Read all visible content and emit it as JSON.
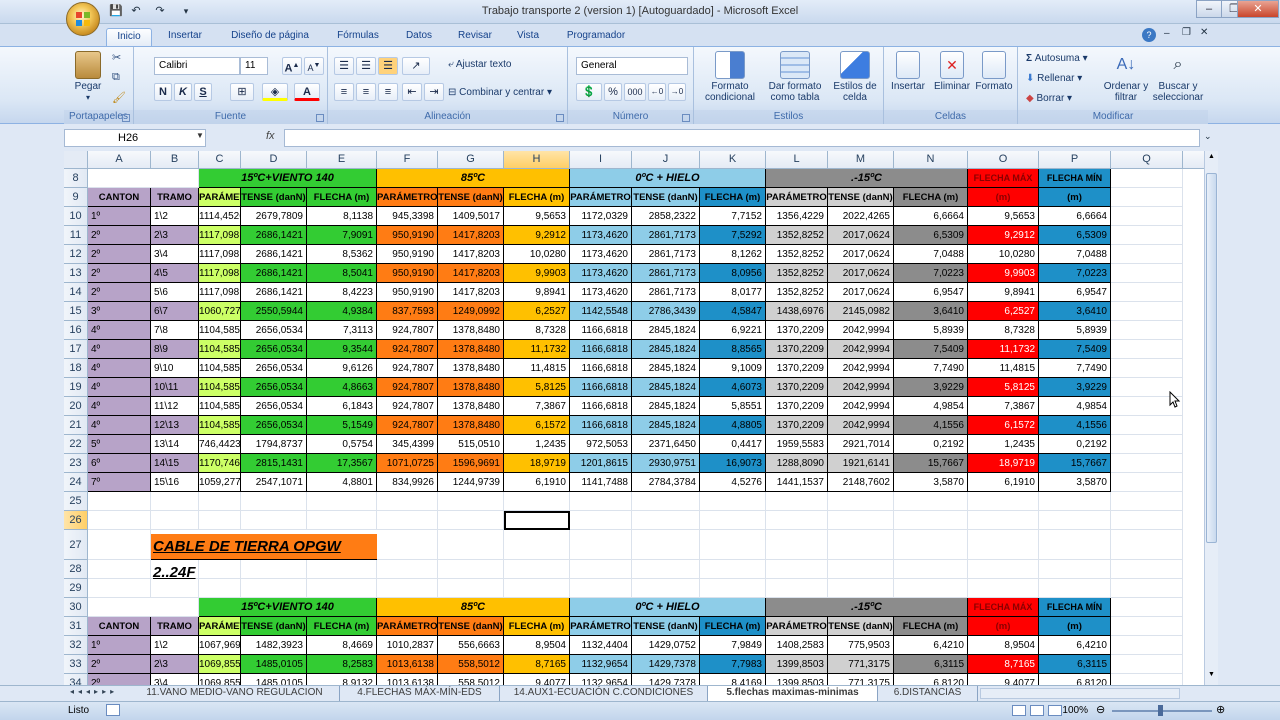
{
  "window": {
    "title": "Trabajo transporte 2 (version 1) [Autoguardado] - Microsoft Excel",
    "min": "–",
    "max": "❐",
    "close": "✕"
  },
  "qat": {
    "save": "💾",
    "undo": "↶",
    "redo": "↷"
  },
  "tabs": [
    "Inicio",
    "Insertar",
    "Diseño de página",
    "Fórmulas",
    "Datos",
    "Revisar",
    "Vista",
    "Programador"
  ],
  "ribbon": {
    "groups": {
      "clipboard": "Portapapeles",
      "font": "Fuente",
      "alignment": "Alineación",
      "number": "Número",
      "styles": "Estilos",
      "cells": "Celdas",
      "editing": "Modificar"
    },
    "paste": "Pegar",
    "font_name": "Calibri",
    "font_size": "11",
    "bold": "N",
    "italic": "K",
    "underline": "S",
    "wrap": "Ajustar texto",
    "merge": "Combinar y centrar",
    "number_format": "General",
    "cond_format": "Formato condicional",
    "table_format": "Dar formato como tabla",
    "cell_styles": "Estilos de celda",
    "insert": "Insertar",
    "delete": "Eliminar",
    "format": "Formato",
    "autosum": "Autosuma",
    "fill": "Rellenar",
    "clear": "Borrar",
    "sort": "Ordenar y filtrar",
    "find": "Buscar y seleccionar"
  },
  "formula_bar": {
    "name_box": "H26",
    "fx": "fx",
    "content": ""
  },
  "columns": [
    "A",
    "B",
    "C",
    "D",
    "E",
    "F",
    "G",
    "H",
    "I",
    "J",
    "K",
    "L",
    "M",
    "N",
    "O",
    "P",
    "Q"
  ],
  "table1": {
    "groups": [
      "15ºC+VIENTO 140",
      "85ºC",
      "0ºC + HIELO",
      ".-15ºC",
      "FLECHA MÁX",
      "FLECHA MÍN"
    ],
    "headers": [
      "CANTON",
      "TRAMO",
      "PARÁMETRO",
      "TENSE (danN)",
      "FLECHA (m)",
      "PARÁMETRO",
      "TENSE (danN)",
      "FLECHA (m)",
      "PARÁMETRO",
      "TENSE (danN)",
      "FLECHA (m)",
      "PARÁMETRO",
      "TENSE (danN)",
      "FLECHA (m)",
      "(m)",
      "(m)"
    ],
    "rows": [
      [
        "1º",
        "1\\2",
        "1114,4526",
        "2679,7809",
        "8,1138",
        "945,3398",
        "1409,5017",
        "9,5653",
        "1172,0329",
        "2858,2322",
        "7,7152",
        "1356,4229",
        "2022,4265",
        "6,6664",
        "9,5653",
        "6,6664"
      ],
      [
        "2º",
        "2\\3",
        "1117,0981",
        "2686,1421",
        "7,9091",
        "950,9190",
        "1417,8203",
        "9,2912",
        "1173,4620",
        "2861,7173",
        "7,5292",
        "1352,8252",
        "2017,0624",
        "6,5309",
        "9,2912",
        "6,5309"
      ],
      [
        "2º",
        "3\\4",
        "1117,0981",
        "2686,1421",
        "8,5362",
        "950,9190",
        "1417,8203",
        "10,0280",
        "1173,4620",
        "2861,7173",
        "8,1262",
        "1352,8252",
        "2017,0624",
        "7,0488",
        "10,0280",
        "7,0488"
      ],
      [
        "2º",
        "4\\5",
        "1117,0981",
        "2686,1421",
        "8,5041",
        "950,9190",
        "1417,8203",
        "9,9903",
        "1173,4620",
        "2861,7173",
        "8,0956",
        "1352,8252",
        "2017,0624",
        "7,0223",
        "9,9903",
        "7,0223"
      ],
      [
        "2º",
        "5\\6",
        "1117,0981",
        "2686,1421",
        "8,4223",
        "950,9190",
        "1417,8203",
        "9,8941",
        "1173,4620",
        "2861,7173",
        "8,0177",
        "1352,8252",
        "2017,0624",
        "6,9547",
        "9,8941",
        "6,9547"
      ],
      [
        "3º",
        "6\\7",
        "1060,7273",
        "2550,5944",
        "4,9384",
        "837,7593",
        "1249,0992",
        "6,2527",
        "1142,5548",
        "2786,3439",
        "4,5847",
        "1438,6976",
        "2145,0982",
        "3,6410",
        "6,2527",
        "3,6410"
      ],
      [
        "4º",
        "7\\8",
        "1104,5850",
        "2656,0534",
        "7,3113",
        "924,7807",
        "1378,8480",
        "8,7328",
        "1166,6818",
        "2845,1824",
        "6,9221",
        "1370,2209",
        "2042,9994",
        "5,8939",
        "8,7328",
        "5,8939"
      ],
      [
        "4º",
        "8\\9",
        "1104,5850",
        "2656,0534",
        "9,3544",
        "924,7807",
        "1378,8480",
        "11,1732",
        "1166,6818",
        "2845,1824",
        "8,8565",
        "1370,2209",
        "2042,9994",
        "7,5409",
        "11,1732",
        "7,5409"
      ],
      [
        "4º",
        "9\\10",
        "1104,5850",
        "2656,0534",
        "9,6126",
        "924,7807",
        "1378,8480",
        "11,4815",
        "1166,6818",
        "2845,1824",
        "9,1009",
        "1370,2209",
        "2042,9994",
        "7,7490",
        "11,4815",
        "7,7490"
      ],
      [
        "4º",
        "10\\11",
        "1104,5850",
        "2656,0534",
        "4,8663",
        "924,7807",
        "1378,8480",
        "5,8125",
        "1166,6818",
        "2845,1824",
        "4,6073",
        "1370,2209",
        "2042,9994",
        "3,9229",
        "5,8125",
        "3,9229"
      ],
      [
        "4º",
        "11\\12",
        "1104,5850",
        "2656,0534",
        "6,1843",
        "924,7807",
        "1378,8480",
        "7,3867",
        "1166,6818",
        "2845,1824",
        "5,8551",
        "1370,2209",
        "2042,9994",
        "4,9854",
        "7,3867",
        "4,9854"
      ],
      [
        "4º",
        "12\\13",
        "1104,5850",
        "2656,0534",
        "5,1549",
        "924,7807",
        "1378,8480",
        "6,1572",
        "1166,6818",
        "2845,1824",
        "4,8805",
        "1370,2209",
        "2042,9994",
        "4,1556",
        "6,1572",
        "4,1556"
      ],
      [
        "5º",
        "13\\14",
        "746,4423",
        "1794,8737",
        "0,5754",
        "345,4399",
        "515,0510",
        "1,2435",
        "972,5053",
        "2371,6450",
        "0,4417",
        "1959,5583",
        "2921,7014",
        "0,2192",
        "1,2435",
        "0,2192"
      ],
      [
        "6º",
        "14\\15",
        "1170,7464",
        "2815,1431",
        "17,3567",
        "1071,0725",
        "1596,9691",
        "18,9719",
        "1201,8615",
        "2930,9751",
        "16,9073",
        "1288,8090",
        "1921,6141",
        "15,7667",
        "18,9719",
        "15,7667"
      ],
      [
        "7º",
        "15\\16",
        "1059,2770",
        "2547,1071",
        "4,8801",
        "834,9926",
        "1244,9739",
        "6,1910",
        "1141,7488",
        "2784,3784",
        "4,5276",
        "1441,1537",
        "2148,7602",
        "3,5870",
        "6,1910",
        "3,5870"
      ]
    ]
  },
  "section_title": "CABLE DE TIERRA OPGW 2..24F",
  "table2": {
    "rows": [
      [
        "1º",
        "1\\2",
        "1067,9691",
        "1482,3923",
        "8,4669",
        "1010,2837",
        "556,6663",
        "8,9504",
        "1132,4404",
        "1429,0752",
        "7,9849",
        "1408,2583",
        "775,9503",
        "6,4210",
        "8,9504",
        "6,4210"
      ],
      [
        "2º",
        "2\\3",
        "1069,8554",
        "1485,0105",
        "8,2583",
        "1013,6138",
        "558,5012",
        "8,7165",
        "1132,9654",
        "1429,7378",
        "7,7983",
        "1399,8503",
        "771,3175",
        "6,3115",
        "8,7165",
        "6,3115"
      ],
      [
        "2º",
        "3\\4",
        "1069,8554",
        "1485,0105",
        "8,9132",
        "1013,6138",
        "558,5012",
        "9,4077",
        "1132,9654",
        "1429,7378",
        "8,4169",
        "1399,8503",
        "771,3175",
        "6,8120",
        "9,4077",
        "6,8120"
      ]
    ]
  },
  "sheet_tabs": [
    "11.VANO MEDIO-VANO REGULACION",
    "4.FLECHAS MÁX-MÍN-EDS",
    "14.AUX1-ECUACIÓN C.CONDICIONES",
    "5.flechas maximas-minimas",
    "6.DISTANCIAS"
  ],
  "status": {
    "ready": "Listo",
    "zoom": "100%"
  },
  "colors": {
    "green_light": "#ccff66",
    "green": "#33cc33",
    "orange_light": "#ffc000",
    "orange": "#ff7c14",
    "blue_light": "#8ecde8",
    "blue": "#1e90c8",
    "gray_light": "#d0d0d0",
    "gray": "#8c8c8c",
    "red": "#ff0000",
    "purple": "#b7a3c8",
    "canton_bg": "#b7a3c8"
  }
}
